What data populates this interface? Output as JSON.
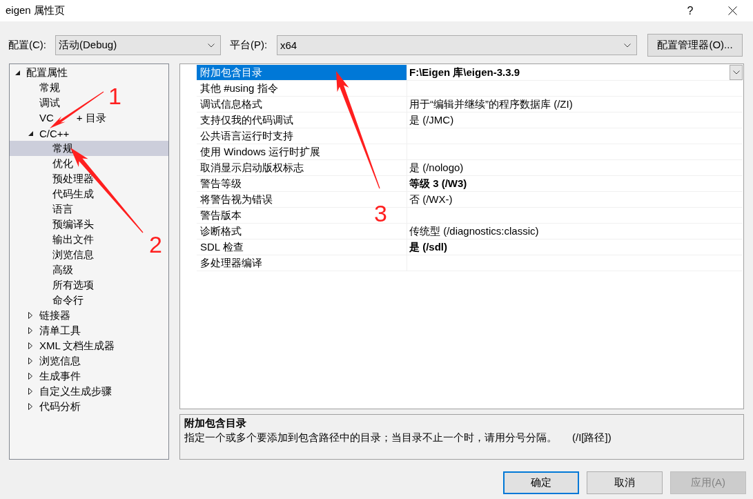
{
  "window": {
    "title": "eigen 属性页",
    "help_button": "?"
  },
  "config_bar": {
    "configuration": {
      "label": "配置(C):",
      "value": "活动(Debug)"
    },
    "platform": {
      "label": "平台(P):",
      "value": "x64"
    },
    "manager_button": "配置管理器(O)..."
  },
  "tree": {
    "items": [
      {
        "label": "配置属性",
        "expanded": true,
        "selected": false,
        "children": [
          {
            "label": "常规",
            "selected": false
          },
          {
            "label": "调试",
            "selected": false
          },
          {
            "label_parts": [
              "VC",
              "+ 目录"
            ],
            "selected": false
          },
          {
            "label": "C/C++",
            "expanded": true,
            "selected": false,
            "children": [
              {
                "label": "常规",
                "selected": true
              },
              {
                "label": "优化",
                "selected": false
              },
              {
                "label": "预处理器",
                "selected": false
              },
              {
                "label": "代码生成",
                "selected": false
              },
              {
                "label": "语言",
                "selected": false
              },
              {
                "label": "预编译头",
                "selected": false
              },
              {
                "label": "输出文件",
                "selected": false
              },
              {
                "label": "浏览信息",
                "selected": false
              },
              {
                "label": "高级",
                "selected": false
              },
              {
                "label": "所有选项",
                "selected": false
              },
              {
                "label": "命令行",
                "selected": false
              }
            ]
          },
          {
            "label": "链接器",
            "expanded": false,
            "selected": false
          },
          {
            "label": "清单工具",
            "expanded": false,
            "selected": false
          },
          {
            "label": "XML 文档生成器",
            "expanded": false,
            "selected": false
          },
          {
            "label": "浏览信息",
            "expanded": false,
            "selected": false
          },
          {
            "label": "生成事件",
            "expanded": false,
            "selected": false
          },
          {
            "label": "自定义生成步骤",
            "expanded": false,
            "selected": false
          },
          {
            "label": "代码分析",
            "expanded": false,
            "selected": false
          }
        ]
      }
    ]
  },
  "grid": {
    "rows": [
      {
        "name": "附加包含目录",
        "value": "F:\\Eigen 库\\eigen-3.3.9",
        "overridden": true,
        "selected": true
      },
      {
        "name": "其他 #using 指令",
        "selected": false
      },
      {
        "name": "调试信息格式",
        "value": "用于“编辑并继续”的程序数据库 (/ZI)",
        "overridden": false,
        "selected": false
      },
      {
        "name": "支持仅我的代码调试",
        "value": "是 (/JMC)",
        "overridden": false,
        "selected": false
      },
      {
        "name": "公共语言运行时支持",
        "selected": false
      },
      {
        "name": "使用 Windows 运行时扩展",
        "selected": false
      },
      {
        "name": "取消显示启动版权标志",
        "value": "是 (/nologo)",
        "overridden": false,
        "selected": false
      },
      {
        "name": "警告等级",
        "value": "等级 3 (/W3)",
        "overridden": true,
        "selected": false
      },
      {
        "name": "将警告视为错误",
        "value": "否 (/WX-)",
        "overridden": false,
        "selected": false
      },
      {
        "name": "警告版本",
        "selected": false
      },
      {
        "name": "诊断格式",
        "value": "传统型 (/diagnostics:classic)",
        "overridden": false,
        "selected": false
      },
      {
        "name": "SDL 检查",
        "value": "是 (/sdl)",
        "overridden": true,
        "selected": false
      },
      {
        "name": "多处理器编译",
        "selected": false
      }
    ]
  },
  "description": {
    "title": "附加包含目录",
    "text": "指定一个或多个要添加到包含路径中的目录；当目录不止一个时，请用分号分隔。",
    "switch": "(/I[路径])"
  },
  "buttons": [
    {
      "label": "确定",
      "default": true,
      "disabled": false
    },
    {
      "label": "取消",
      "default": false,
      "disabled": false
    },
    {
      "label": "应用(A)",
      "default": false,
      "disabled": true
    }
  ],
  "annotations": [
    {
      "label": "1"
    },
    {
      "label": "2"
    },
    {
      "label": "3"
    }
  ]
}
